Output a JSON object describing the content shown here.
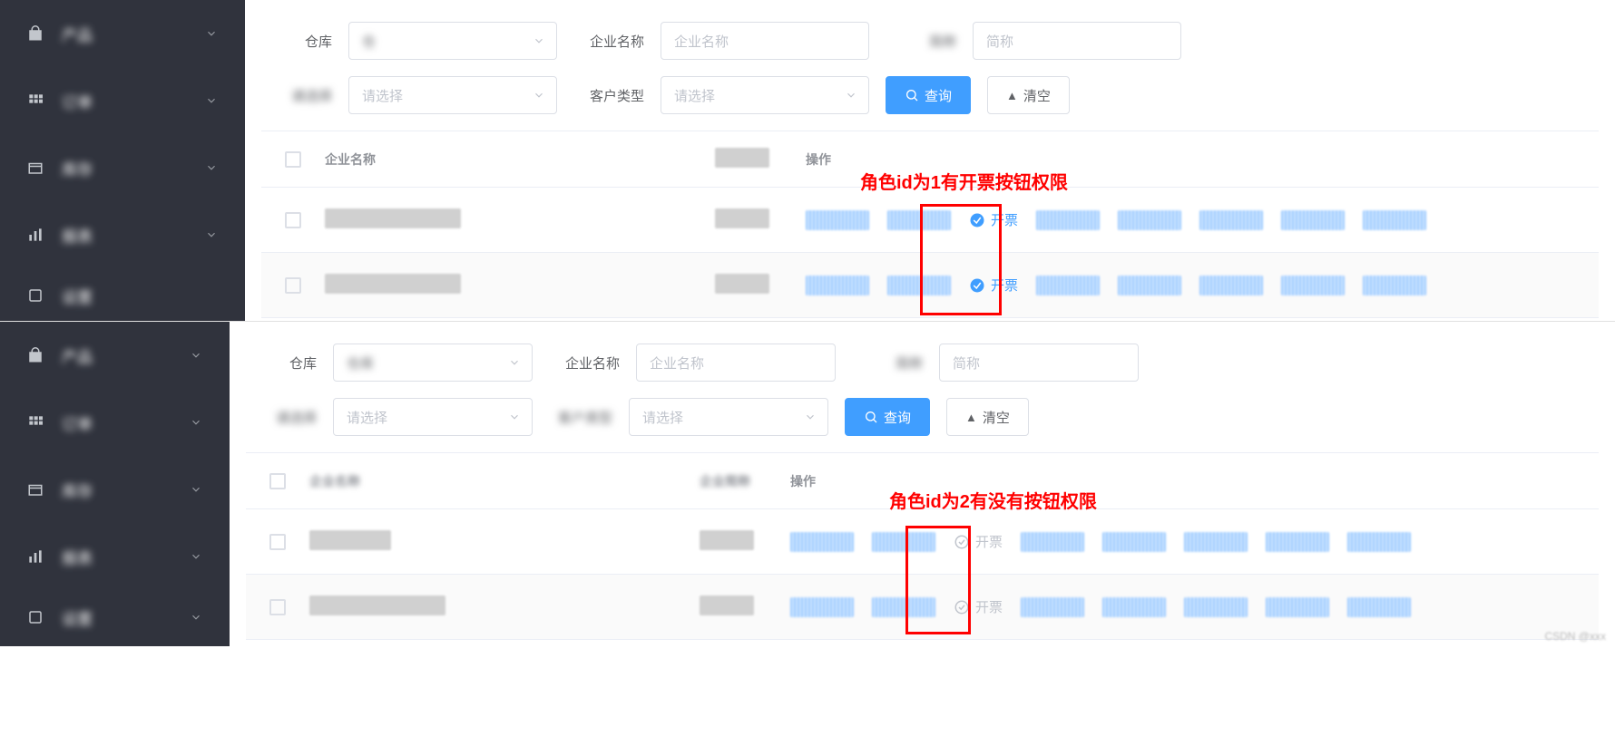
{
  "sidebar": {
    "items": [
      {
        "label": "产品"
      },
      {
        "label": "订单"
      },
      {
        "label": "库存"
      },
      {
        "label": "报表"
      },
      {
        "label": "设置"
      }
    ]
  },
  "filters": {
    "c1_label": "仓库",
    "c1_value": "仓",
    "c1_value_b": "仓库",
    "c2_label": "企业名称",
    "c2_ph": "企业名称",
    "c3_label_blur": "简称",
    "c3_ph": "简称",
    "c4_label_blur": "请选择",
    "c4_ph": "请选择",
    "c5_label": "客户类型",
    "c5_label_b": "客户类型",
    "c5_ph": "请选择",
    "btn_query": "查询",
    "btn_clear": "清空"
  },
  "table": {
    "h_name": "企业名称",
    "h_name_b": "企业名称",
    "h_code_blur": "企业简称",
    "h_ops": "操作"
  },
  "kp_label": "开票",
  "anno": {
    "top": "角色id为1有开票按钮权限",
    "bot": "角色id为2有没有按钮权限"
  }
}
